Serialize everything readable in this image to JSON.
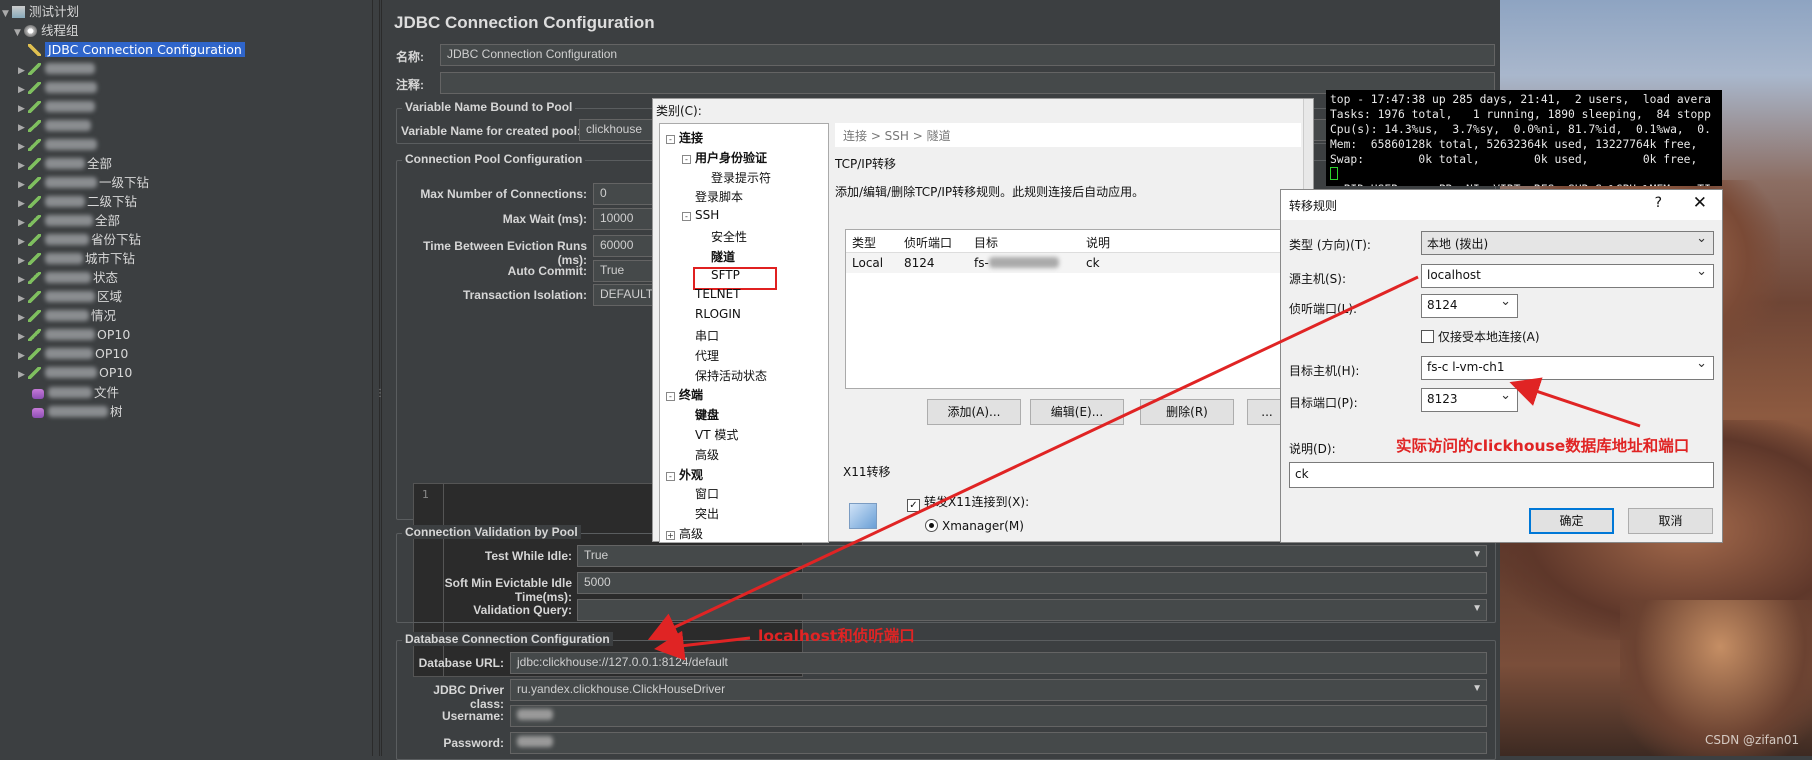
{
  "tree": {
    "test_plan": "测试计划",
    "thread_group": "线程组",
    "selected": "JDBC Connection Configuration",
    "items": [
      {
        "suffix": ""
      },
      {
        "suffix": ""
      },
      {
        "suffix": ""
      },
      {
        "suffix": ""
      },
      {
        "suffix": ""
      },
      {
        "suffix": "全部"
      },
      {
        "suffix": "一级下钻"
      },
      {
        "suffix": "二级下钻"
      },
      {
        "suffix": "全部"
      },
      {
        "suffix": "省份下钻"
      },
      {
        "suffix": "城市下钻"
      },
      {
        "suffix": "状态"
      },
      {
        "suffix": "区域"
      },
      {
        "suffix": "情况"
      },
      {
        "suffix": "OP10"
      },
      {
        "suffix": "OP10"
      },
      {
        "suffix": "OP10"
      }
    ],
    "listeners": [
      {
        "suffix": "文件"
      },
      {
        "suffix": "树"
      }
    ]
  },
  "panel": {
    "title": "JDBC Connection Configuration",
    "name_label": "名称:",
    "name_value": "JDBC Connection Configuration",
    "comment_label": "注释:",
    "var_section": "Variable Name Bound to Pool",
    "var_label": "Variable Name for created pool:",
    "var_value": "clickhouse",
    "pool_section": "Connection Pool Configuration",
    "pool_fields": [
      {
        "label": "Max Number of Connections:",
        "value": "0"
      },
      {
        "label": "Max Wait (ms):",
        "value": "10000"
      },
      {
        "label": "Time Between Eviction Runs (ms):",
        "value": "60000"
      },
      {
        "label": "Auto Commit:",
        "value": "True"
      },
      {
        "label": "Transaction Isolation:",
        "value": "DEFAULT"
      }
    ],
    "editor_line": "1",
    "validation_section": "Connection Validation by Pool",
    "validation_fields": [
      {
        "label": "Test While Idle:",
        "value": "True"
      },
      {
        "label": "Soft Min Evictable Idle Time(ms):",
        "value": "5000"
      },
      {
        "label": "Validation Query:",
        "value": ""
      }
    ],
    "db_section": "Database Connection Configuration",
    "db_fields": [
      {
        "label": "Database URL:",
        "value": "jdbc:clickhouse://127.0.0.1:8124/default"
      },
      {
        "label": "JDBC Driver class:",
        "value": "ru.yandex.clickhouse.ClickHouseDriver"
      },
      {
        "label": "Username:",
        "value": ""
      },
      {
        "label": "Password:",
        "value": ""
      }
    ]
  },
  "ssh_dialog": {
    "category_label": "类别(C):",
    "tree": [
      {
        "label": "连接",
        "bold": true,
        "level": 0,
        "box": "-"
      },
      {
        "label": "用户身份验证",
        "bold": true,
        "level": 1,
        "box": "-"
      },
      {
        "label": "登录提示符",
        "bold": false,
        "level": 2
      },
      {
        "label": "登录脚本",
        "bold": false,
        "level": 1
      },
      {
        "label": "SSH",
        "bold": false,
        "level": 1,
        "box": "-"
      },
      {
        "label": "安全性",
        "bold": false,
        "level": 2
      },
      {
        "label": "隧道",
        "bold": true,
        "level": 2
      },
      {
        "label": "SFTP",
        "bold": false,
        "level": 2
      },
      {
        "label": "TELNET",
        "bold": false,
        "level": 1
      },
      {
        "label": "RLOGIN",
        "bold": false,
        "level": 1
      },
      {
        "label": "串口",
        "bold": false,
        "level": 1
      },
      {
        "label": "代理",
        "bold": false,
        "level": 1
      },
      {
        "label": "保持活动状态",
        "bold": false,
        "level": 1
      },
      {
        "label": "终端",
        "bold": true,
        "level": 0,
        "box": "-"
      },
      {
        "label": "键盘",
        "bold": true,
        "level": 1
      },
      {
        "label": "VT 模式",
        "bold": false,
        "level": 1
      },
      {
        "label": "高级",
        "bold": false,
        "level": 1
      },
      {
        "label": "外观",
        "bold": true,
        "level": 0,
        "box": "-"
      },
      {
        "label": "窗口",
        "bold": false,
        "level": 1
      },
      {
        "label": "突出",
        "bold": false,
        "level": 1
      },
      {
        "label": "高级",
        "bold": false,
        "level": 0,
        "box": "+"
      }
    ],
    "breadcrumb": "连接 > SSH > 隧道",
    "tcp_title": "TCP/IP转移",
    "tcp_desc": "添加/编辑/删除TCP/IP转移规则。此规则连接后自动应用。",
    "table_headers": [
      "类型",
      "侦听端口",
      "目标",
      "说明"
    ],
    "table_row": {
      "type": "Local",
      "port": "8124",
      "target": "fs-",
      "note": "ck"
    },
    "buttons": {
      "add": "添加(A)...",
      "edit": "编辑(E)...",
      "delete": "删除(R)",
      "more": "..."
    },
    "x11_title": "X11转移",
    "x11_checkbox": "转发X11连接到(X):",
    "x11_radio": "Xmanager(M)"
  },
  "terminal": {
    "lines": [
      "top - 17:47:38 up 285 days, 21:41,  2 users,  load avera",
      "Tasks: 1976 total,   1 running, 1890 sleeping,  84 stopp",
      "Cpu(s): 14.3%us,  3.7%sy,  0.0%ni, 81.7%id,  0.1%wa,  0.",
      "Mem:  65860128k total, 52632364k used, 13227764k free,",
      "Swap:        0k total,        0k used,        0k free,",
      "",
      "  PID USER      PR  NI  VIRT  RES  SHR S %CPU %MEM    TI"
    ]
  },
  "forward_dialog": {
    "title": "转移规则",
    "help": "?",
    "close": "✕",
    "type_label": "类型 (方向)(T):",
    "type_value": "本地 (拨出)",
    "source_label": "源主机(S):",
    "source_value": "localhost",
    "listen_label": "侦听端口(L):",
    "listen_value": "8124",
    "local_only": "仅接受本地连接(A)",
    "target_label": "目标主机(H):",
    "target_value": "fs-c      l-vm-ch1",
    "target_port_label": "目标端口(P):",
    "target_port_value": "8123",
    "desc_label": "说明(D):",
    "desc_value": "ck",
    "ok": "确定",
    "cancel": "取消"
  },
  "annotations": {
    "target_note": "实际访问的clickhouse数据库地址和端口",
    "local_note": "localhost和侦听端口",
    "color": "#e02424"
  },
  "watermark": "CSDN @zifan01"
}
